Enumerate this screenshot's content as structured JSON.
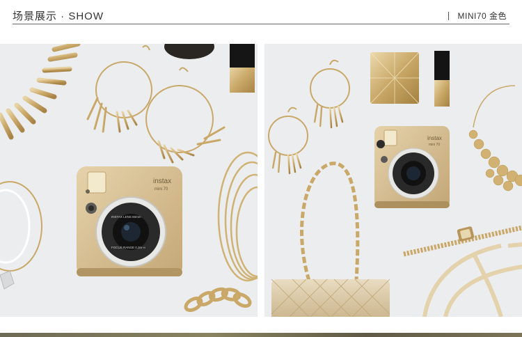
{
  "header": {
    "title": "场景展示 · SHOW",
    "model_label": "MINI70 金色"
  },
  "camera": {
    "brand": "instax",
    "model": "mini 70",
    "lens_top": "INSTAX LENS 60mm",
    "lens_bottom": "FOCUS RANGE 0.3m-∞"
  },
  "colors": {
    "gold": "#c8a96a",
    "camera_body": "#d9c39a",
    "background": "#ecedef"
  }
}
